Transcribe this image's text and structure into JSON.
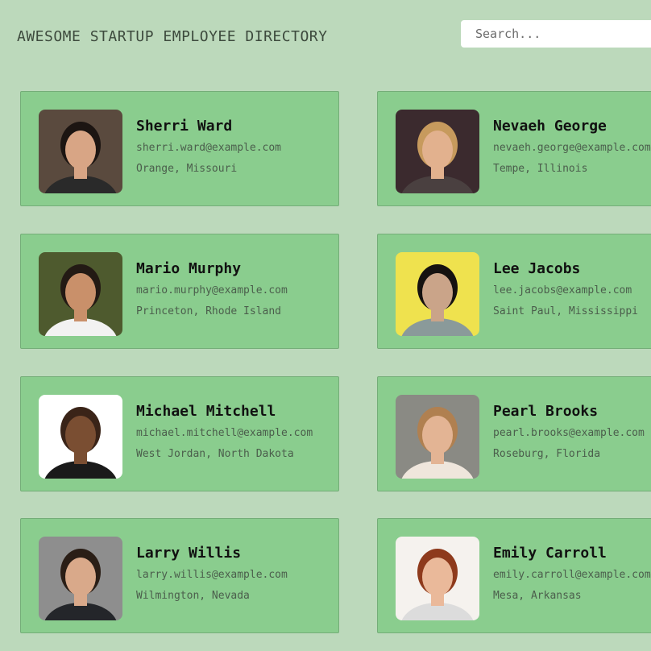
{
  "header": {
    "title": "AWESOME STARTUP EMPLOYEE DIRECTORY"
  },
  "search": {
    "placeholder": "Search..."
  },
  "employees": [
    {
      "name": "Sherri Ward",
      "email": "sherri.ward@example.com",
      "location": "Orange, Missouri",
      "bg": "#5a4a3e",
      "skin": "#d8a585",
      "hair": "#1c1512",
      "shirt": "#2a2a2a"
    },
    {
      "name": "Nevaeh George",
      "email": "nevaeh.george@example.com",
      "location": "Tempe, Illinois",
      "bg": "#3b2a2e",
      "skin": "#e2b18e",
      "hair": "#c79a5d",
      "shirt": "#4a4040"
    },
    {
      "name": "Mario Murphy",
      "email": "mario.murphy@example.com",
      "location": "Princeton, Rhode Island",
      "bg": "#4e5a2e",
      "skin": "#c9906a",
      "hair": "#231a14",
      "shirt": "#f2f2f2"
    },
    {
      "name": "Lee Jacobs",
      "email": "lee.jacobs@example.com",
      "location": "Saint Paul, Mississippi",
      "bg": "#efe24e",
      "skin": "#caa489",
      "hair": "#151210",
      "shirt": "#8a9a9a"
    },
    {
      "name": "Michael Mitchell",
      "email": "michael.mitchell@example.com",
      "location": "West Jordan, North Dakota",
      "bg": "#ffffff",
      "skin": "#7a4e32",
      "hair": "#3a2418",
      "shirt": "#1a1a1a"
    },
    {
      "name": "Pearl Brooks",
      "email": "pearl.brooks@example.com",
      "location": "Roseburg, Florida",
      "bg": "#8a8a84",
      "skin": "#e3b494",
      "hair": "#b08050",
      "shirt": "#efe6dc"
    },
    {
      "name": "Larry Willis",
      "email": "larry.willis@example.com",
      "location": "Wilmington, Nevada",
      "bg": "#8e8e8e",
      "skin": "#d9a98a",
      "hair": "#2a1e16",
      "shirt": "#24262a"
    },
    {
      "name": "Emily Carroll",
      "email": "emily.carroll@example.com",
      "location": "Mesa, Arkansas",
      "bg": "#f5f2ee",
      "skin": "#eab99a",
      "hair": "#8e3a1c",
      "shirt": "#dcdcdc"
    }
  ]
}
